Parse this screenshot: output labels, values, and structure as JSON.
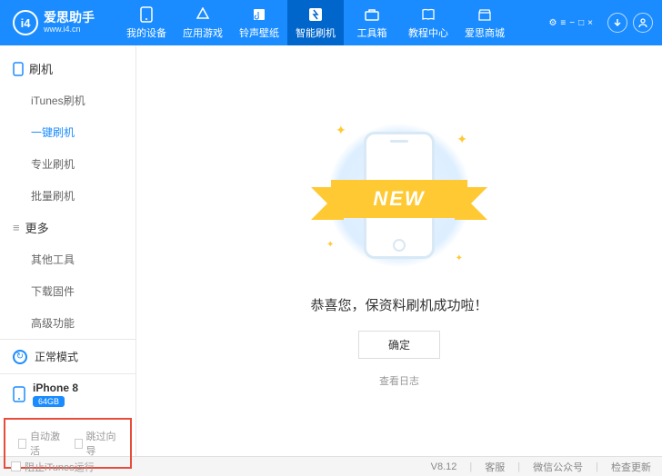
{
  "app": {
    "title": "爱思助手",
    "subtitle": "www.i4.cn",
    "logo": "i4"
  },
  "nav": [
    {
      "label": "我的设备",
      "icon": "device"
    },
    {
      "label": "应用游戏",
      "icon": "apps"
    },
    {
      "label": "铃声壁纸",
      "icon": "ringtone"
    },
    {
      "label": "智能刷机",
      "icon": "flash",
      "active": true
    },
    {
      "label": "工具箱",
      "icon": "toolbox"
    },
    {
      "label": "教程中心",
      "icon": "tutorial"
    },
    {
      "label": "爱思商城",
      "icon": "store"
    }
  ],
  "sidebar": {
    "group1": {
      "title": "刷机",
      "items": [
        "iTunes刷机",
        "一键刷机",
        "专业刷机",
        "批量刷机"
      ],
      "activeIndex": 1
    },
    "group2": {
      "title": "更多",
      "items": [
        "其他工具",
        "下载固件",
        "高级功能"
      ]
    }
  },
  "mode": {
    "label": "正常模式"
  },
  "device": {
    "name": "iPhone 8",
    "storage": "64GB"
  },
  "checkboxes": {
    "autoActivate": "自动激活",
    "skipGuide": "跳过向导"
  },
  "content": {
    "ribbon": "NEW",
    "successText": "恭喜您，保资料刷机成功啦！",
    "okButton": "确定",
    "logLink": "查看日志"
  },
  "footer": {
    "blockItunes": "阻止iTunes运行",
    "version": "V8.12",
    "support": "客服",
    "wechat": "微信公众号",
    "update": "检查更新"
  }
}
